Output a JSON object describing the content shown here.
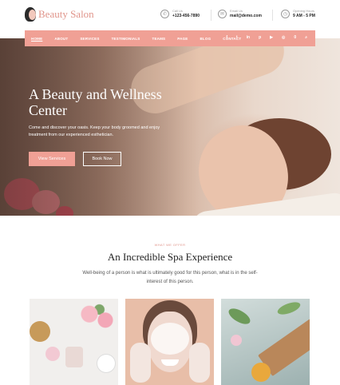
{
  "brand": {
    "name": "Beauty Salon",
    "logo_icon": "woman-silhouette-icon"
  },
  "contacts": [
    {
      "icon": "phone-icon",
      "label": "Call Us",
      "value": "+123-456-7890"
    },
    {
      "icon": "mail-icon",
      "label": "Email Us",
      "value": "mail@demo.com"
    },
    {
      "icon": "clock-icon",
      "label": "Opening Hours",
      "value": "9 AM - 5 PM"
    }
  ],
  "nav": {
    "items": [
      "HOME",
      "ABOUT",
      "SERVICES",
      "TESTIMONIALS",
      "TEAMS",
      "PAGE",
      "BLOG",
      "CONTACT"
    ],
    "active": "HOME",
    "social_icons": [
      "facebook-icon",
      "twitter-icon",
      "linkedin-icon",
      "pinterest-icon",
      "youtube-icon",
      "instagram-icon",
      "cart-icon",
      "search-icon"
    ],
    "social_glyphs": [
      "f",
      "t",
      "in",
      "p",
      "▶",
      "◎",
      "🛒",
      "⌕"
    ],
    "cart_count": "0"
  },
  "hero": {
    "title": "A Beauty and Wellness Center",
    "text": "Come and discover your oasis. Keep your body groomed and enjoy treatment from our experienced esthetician.",
    "primary_button": "View Services",
    "secondary_button": "Book Now"
  },
  "section": {
    "eyebrow": "WHAT WE OFFER",
    "title": "An Incredible Spa Experience",
    "text": "Well-being of a person is what is ultimately good for this person, what is in the self-interest of this person."
  },
  "colors": {
    "accent": "#f0a095",
    "logo": "#e0948a"
  }
}
